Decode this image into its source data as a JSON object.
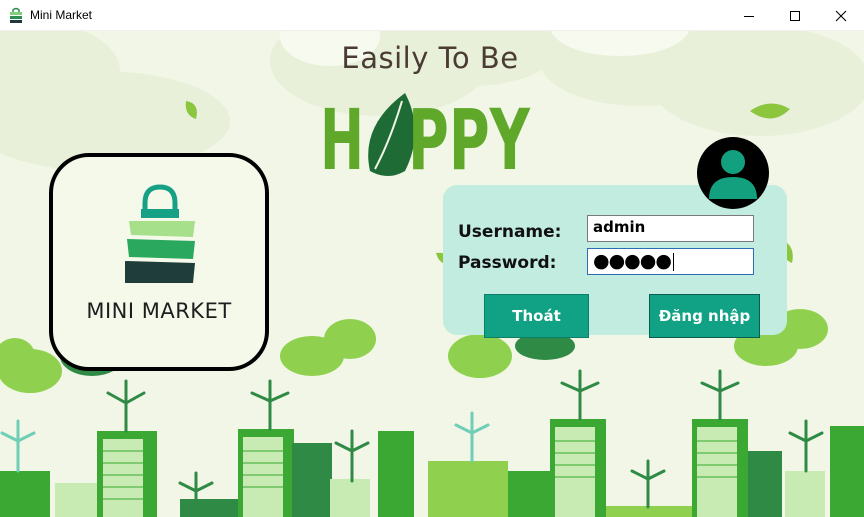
{
  "window": {
    "title": "Mini Market",
    "minimize_icon": "minimize-icon",
    "maximize_icon": "maximize-icon",
    "close_icon": "close-icon"
  },
  "banner": {
    "tagline": "Easily To Be",
    "headline": "HAPPY"
  },
  "logo": {
    "text": "MINI MARKET",
    "icon": "shopping-bag-icon"
  },
  "login": {
    "username_label": "Username:",
    "password_label": "Password:",
    "username_value": "admin",
    "password_masked": "●●●●●",
    "exit_label": "Thoát",
    "login_label": "Đăng nhập",
    "avatar_icon": "user-icon"
  },
  "colors": {
    "background": "#f1f6e6",
    "panel": "#c2ece0",
    "button": "#11a184",
    "city_green": "#3aa832",
    "dark_green": "#1f6b35"
  }
}
